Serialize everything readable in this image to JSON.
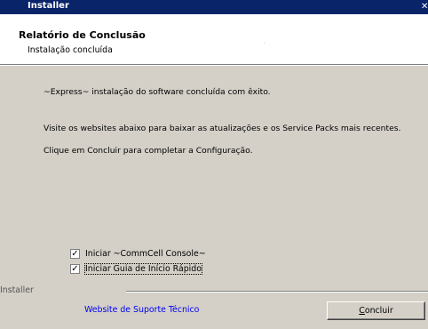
{
  "window": {
    "title": "Installer",
    "close_glyph": "✕"
  },
  "header": {
    "title": "Relatório de Conclusão",
    "subtitle": "Instalação concluída"
  },
  "body": {
    "message_1": "~Express~ instalação do software concluída com êxito.",
    "message_2": "Visite os websites abaixo para baixar as atualizações e os Service Packs mais recentes.",
    "message_3": "Clique em Concluir para completar a Configuração."
  },
  "options": [
    {
      "label": "Iniciar ~CommCell Console~",
      "checked": true
    },
    {
      "label": "Iniciar Guia de Início Rápido",
      "checked": true
    }
  ],
  "footer": {
    "brand": "Installer",
    "support_link": "Website de Suporte Técnico",
    "finish_button_first": "C",
    "finish_button_rest": "oncluir"
  },
  "colors": {
    "titlebar": "#0a246a",
    "dialog": "#d4d0c8",
    "header_bg": "#ffffff",
    "link": "#0000ee"
  }
}
